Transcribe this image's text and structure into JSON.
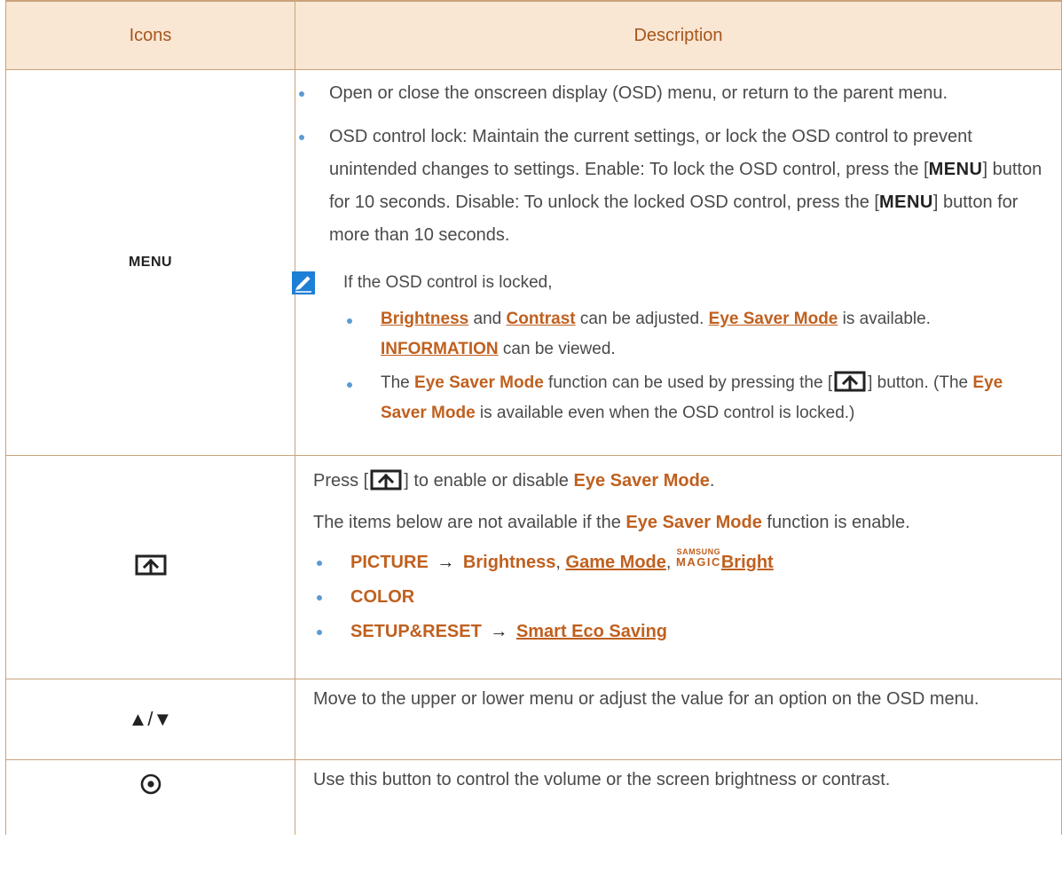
{
  "header": {
    "icons": "Icons",
    "description": "Description"
  },
  "rows": {
    "menu": {
      "icon_label": "MENU",
      "b1": "Open or close the onscreen display (OSD) menu, or return to the parent menu.",
      "b2_a": "OSD control lock: Maintain the current settings, or lock the OSD control to prevent unintended changes to settings. Enable: To lock the OSD control, press the [",
      "key": "MENU",
      "b2_b": "] button for 10 seconds. Disable: To unlock the locked OSD control, press the [",
      "b2_c": "] button for more than 10 seconds.",
      "note_title": "If the OSD control is locked,",
      "n1_brightness": "Brightness",
      "n1_and": " and ",
      "n1_contrast": "Contrast",
      "n1_adj": " can be adjusted. ",
      "n1_eye": "Eye Saver Mode",
      "n1_is": " is available. ",
      "n1_info": "INFORMATION",
      "n1_view": " can be viewed.",
      "n2_a": "The ",
      "n2_eye": "Eye Saver Mode",
      "n2_b": " function can be used by pressing the [",
      "n2_c": "] button. (The ",
      "n2_eye2": "Eye Saver Mode",
      "n2_d": " is available even when the OSD control is locked.)"
    },
    "eye": {
      "l1_a": "Press [",
      "l1_b": "] to enable or disable ",
      "l1_eye": "Eye Saver Mode",
      "l1_c": ".",
      "l2_a": "The items below are not available if the ",
      "l2_eye": "Eye Saver Mode",
      "l2_b": " function is enable.",
      "i1_pic": "PICTURE",
      "arrow": "→",
      "i1_bright": "Brightness",
      "comma": ",",
      "i1_game": "Game Mode",
      "magic_top": "SAMSUNG",
      "magic_bottom": "MAGIC",
      "i1_magic": "Bright",
      "i2": "COLOR",
      "i3_setup": "SETUP&RESET",
      "i3_smart": "Smart Eco Saving"
    },
    "updown": {
      "icon_label": "▲/▼",
      "text": "Move to the upper or lower menu or adjust the value for an option on the OSD menu."
    },
    "joy": {
      "icon_label": "⊙",
      "text": "Use this button to control the volume or the screen brightness or contrast."
    }
  },
  "colors": {
    "accent": "#c0601f",
    "header_bg": "#f9e6d3",
    "border": "#c9a37a",
    "bullet": "#5b9bd5"
  },
  "icons": [
    "note-pencil-icon",
    "eye-saver-key-icon",
    "up-down-arrows-icon",
    "joystick-icon"
  ]
}
